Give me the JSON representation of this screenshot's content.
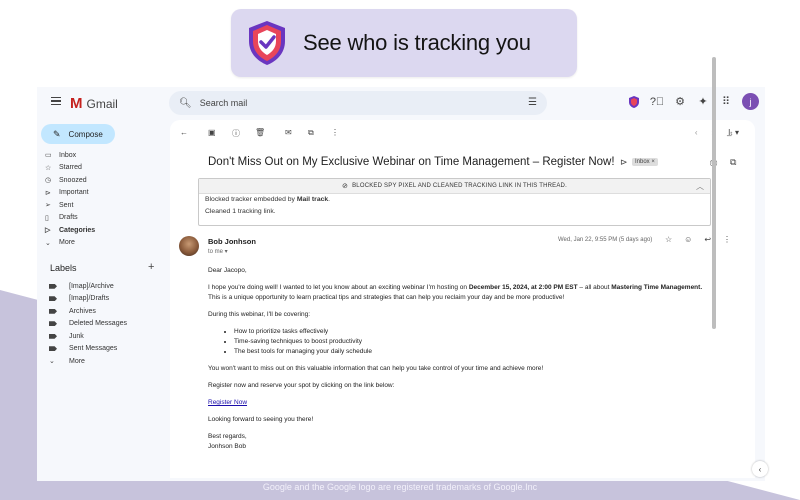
{
  "promo": {
    "text": "See who is tracking you"
  },
  "gmail": {
    "logo_text": "Gmail",
    "search_placeholder": "Search mail",
    "avatar_letter": "j"
  },
  "sidebar": {
    "compose_label": "Compose",
    "items": [
      {
        "label": "Inbox",
        "icon": "inbox-icon",
        "glyph": "▭"
      },
      {
        "label": "Starred",
        "icon": "star-icon",
        "glyph": "☆"
      },
      {
        "label": "Snoozed",
        "icon": "clock-icon",
        "glyph": "◷"
      },
      {
        "label": "Important",
        "icon": "important-icon",
        "glyph": "⊳"
      },
      {
        "label": "Sent",
        "icon": "send-icon",
        "glyph": "➢"
      },
      {
        "label": "Drafts",
        "icon": "draft-icon",
        "glyph": "▯"
      },
      {
        "label": "Categories",
        "icon": "label-icon",
        "glyph": "▷"
      },
      {
        "label": "More",
        "icon": "chevron-down-icon",
        "glyph": "⌄"
      }
    ],
    "labels_heading": "Labels",
    "labels": [
      {
        "label": "[Imap]/Archive"
      },
      {
        "label": "[Imap]/Drafts"
      },
      {
        "label": "Archives"
      },
      {
        "label": "Deleted Messages"
      },
      {
        "label": "Junk"
      },
      {
        "label": "Sent Messages"
      },
      {
        "label": "More"
      }
    ]
  },
  "email": {
    "subject": "Don't Miss Out on My Exclusive Webinar on Time Management – Register Now!",
    "badge": "Inbox ×",
    "tracker_header": "BLOCKED SPY PIXEL AND CLEANED TRACKING LINK IN THIS THREAD.",
    "tracker_line1_pre": "Blocked tracker embedded by ",
    "tracker_line1_bold": "Mail track",
    "tracker_line1_post": ".",
    "tracker_line2": "Cleaned 1 tracking link.",
    "sender": "Bob Jonhson",
    "to_me": "to me ▾",
    "date": "Wed, Jan 22, 9:55 PM (5 days ago)",
    "greeting": "Dear Jacopo,",
    "p1_a": "I hope you're doing well! I wanted to let you know about an exciting webinar I'm hosting on ",
    "p1_date": "December 15, 2024, at 2:00 PM EST",
    "p1_b": " – all about ",
    "p1_topic": "Mastering Time Management.",
    "p1_c": "This is a unique opportunity to learn practical tips and strategies that can help you reclaim your day and be more productive!",
    "p2": "During this webinar, I'll be covering:",
    "bullets": [
      "How to prioritize tasks effectively",
      "Time-saving techniques to boost productivity",
      "The best tools for managing your daily schedule"
    ],
    "p3": "You won't want to miss out on this valuable information that can help you take control of your time and achieve more!",
    "p4": "Register now and reserve your spot by clicking on the link below:",
    "link": "Register Now",
    "p5": "Looking forward to seeing you there!",
    "signoff": "Best regards,",
    "signature": "Jonhson Bob"
  },
  "footer": {
    "text": "Google and the Google logo are registered trademarks of Google.Inc"
  },
  "colors": {
    "accent": "#c2e7ff",
    "shield": "#7a3cc4",
    "background": "#c7c3dc"
  }
}
